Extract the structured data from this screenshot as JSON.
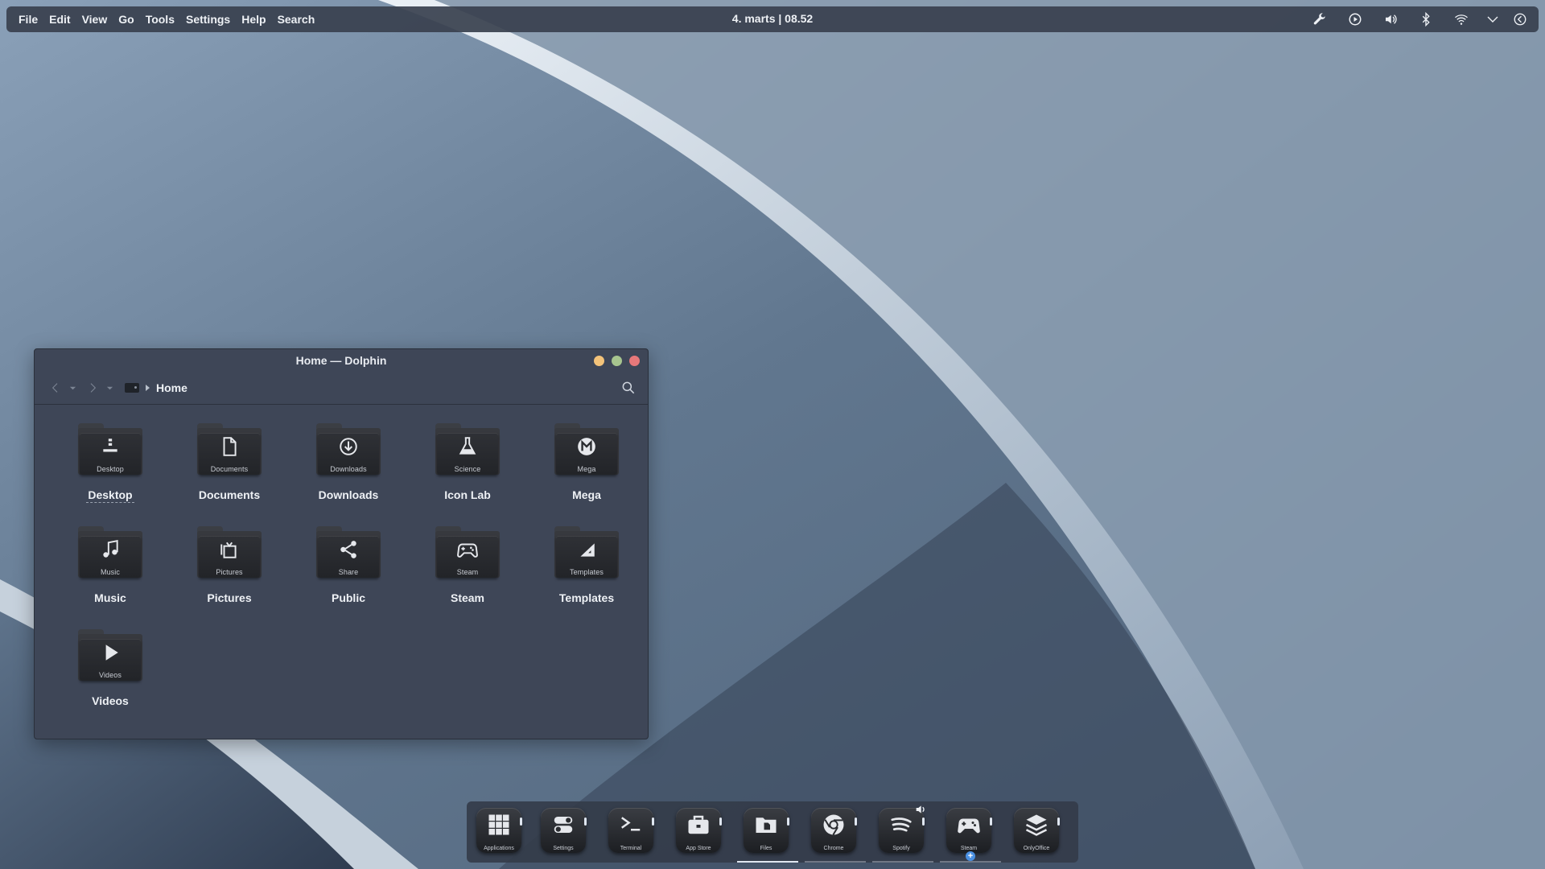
{
  "menubar": {
    "items": [
      "File",
      "Edit",
      "View",
      "Go",
      "Tools",
      "Settings",
      "Help",
      "Search"
    ],
    "clock": "4. marts | 08.52",
    "tray_icons": [
      "wrench-icon",
      "play-circle-icon",
      "volume-icon",
      "bluetooth-icon",
      "wifi-icon",
      "chevron-down-icon",
      "back-circle-icon"
    ]
  },
  "window": {
    "title": "Home — Dolphin",
    "breadcrumb": {
      "current": "Home"
    },
    "items": [
      {
        "name": "Desktop",
        "folder_label": "Desktop",
        "icon": "desktop-icon",
        "focused": true
      },
      {
        "name": "Documents",
        "folder_label": "Documents",
        "icon": "document-icon"
      },
      {
        "name": "Downloads",
        "folder_label": "Downloads",
        "icon": "download-icon"
      },
      {
        "name": "Icon Lab",
        "folder_label": "Science",
        "icon": "flask-icon"
      },
      {
        "name": "Mega",
        "folder_label": "Mega",
        "icon": "mega-icon"
      },
      {
        "name": "Music",
        "folder_label": "Music",
        "icon": "music-note-icon"
      },
      {
        "name": "Pictures",
        "folder_label": "Pictures",
        "icon": "picture-frame-icon"
      },
      {
        "name": "Public",
        "folder_label": "Share",
        "icon": "share-icon"
      },
      {
        "name": "Steam",
        "folder_label": "Steam",
        "icon": "gamepad-icon"
      },
      {
        "name": "Templates",
        "folder_label": "Templates",
        "icon": "template-triangle-icon"
      },
      {
        "name": "Videos",
        "folder_label": "Videos",
        "icon": "play-icon"
      }
    ]
  },
  "dock": {
    "items": [
      {
        "label": "Applications",
        "icon": "grid-icon"
      },
      {
        "label": "Settings",
        "icon": "toggles-icon"
      },
      {
        "label": "Terminal",
        "icon": "terminal-icon"
      },
      {
        "label": "App Store",
        "icon": "briefcase-icon"
      },
      {
        "label": "Files",
        "icon": "files-icon",
        "active": true
      },
      {
        "label": "Chrome",
        "icon": "chrome-icon"
      },
      {
        "label": "Spotify",
        "icon": "spotify-icon"
      },
      {
        "label": "Steam",
        "icon": "gamepad-icon"
      },
      {
        "label": "OnlyOffice",
        "icon": "layers-icon"
      }
    ]
  },
  "colors": {
    "accent": "#4a90e2",
    "minimize": "#f3c37a",
    "maximize": "#a7c58f",
    "close": "#e7787a"
  }
}
